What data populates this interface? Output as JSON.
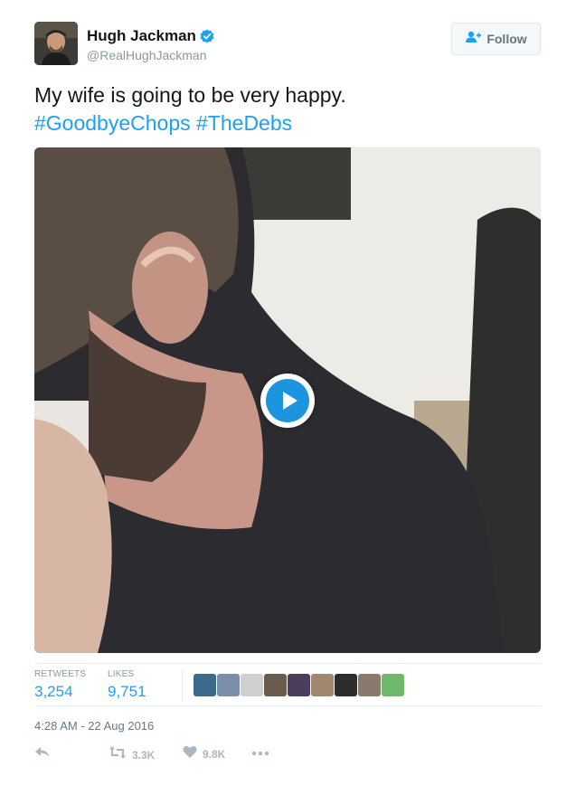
{
  "author": {
    "name": "Hugh Jackman",
    "handle": "@RealHughJackman",
    "verified": true
  },
  "follow_button": {
    "label": "Follow"
  },
  "tweet": {
    "text": "My wife is going to be very happy.",
    "hashtags": [
      "#GoodbyeChops",
      "#TheDebs"
    ]
  },
  "media": {
    "type": "video",
    "play_icon": "play-icon"
  },
  "stats": {
    "retweets_label": "RETWEETS",
    "retweets_value": "3,254",
    "likes_label": "LIKES",
    "likes_value": "9,751",
    "liker_count": 9
  },
  "timestamp": "4:28 AM - 22 Aug 2016",
  "actions": {
    "reply_icon": "reply-icon",
    "retweet_icon": "retweet-icon",
    "retweet_count": "3.3K",
    "like_icon": "heart-icon",
    "like_count": "9.8K",
    "more_icon": "more-icon"
  },
  "colors": {
    "link": "#1da1f2",
    "text": "#14171a",
    "muted": "#8899a6",
    "play": "#1b95e0"
  }
}
